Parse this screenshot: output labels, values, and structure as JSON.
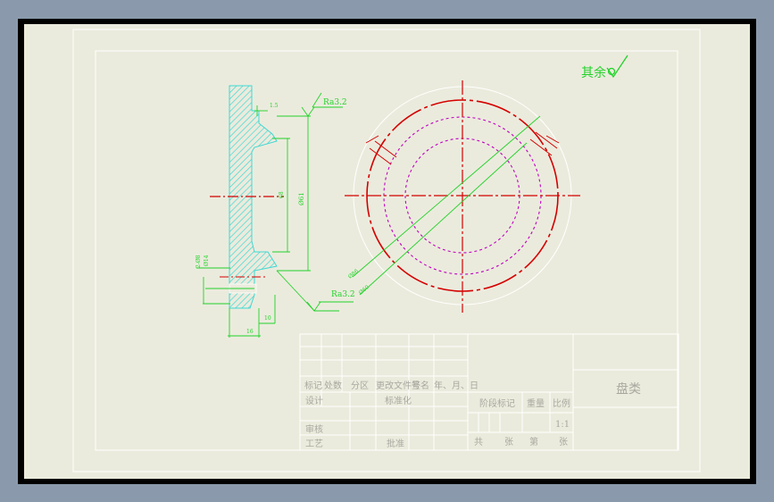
{
  "note": {
    "qiyu": "其余"
  },
  "roughness": {
    "top": "Ra3.2",
    "bottom": "Ra3.2"
  },
  "dims": {
    "top_small": "1.5",
    "vertical_main": "Ø61",
    "inner": "68",
    "left_a": "2-Ø8",
    "left_b": "Ø14",
    "bottom_a": "10",
    "bottom_b": "16",
    "circle_a": "Ø86",
    "circle_b": "Ø60"
  },
  "title_block": {
    "headers": [
      "标记",
      "处数",
      "分区",
      "更改文件号",
      "签名",
      "年、月、日"
    ],
    "rows": [
      "设计",
      "审核",
      "工艺"
    ],
    "standardize": "标准化",
    "approve": "批准",
    "stage_label": "阶段标记",
    "weight_label": "重量",
    "scale_label": "比例",
    "scale_value": "1:1",
    "part_name": "盘类",
    "sheet_footer": [
      "共",
      "张",
      "第",
      "张"
    ]
  },
  "colors": {
    "sheet": "#ebebdd",
    "border": "#ffffff",
    "hatch": "#3fd8d2",
    "dimension": "#22d22a",
    "center": "#d40000",
    "hidden": "#c000c0"
  }
}
